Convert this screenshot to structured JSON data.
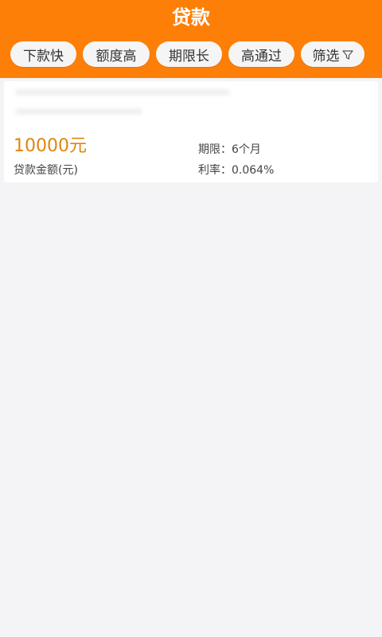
{
  "header": {
    "title": "贷款",
    "background_color": "#fd7f07"
  },
  "filters": [
    {
      "label": "下款快"
    },
    {
      "label": "额度高"
    },
    {
      "label": "期限长"
    },
    {
      "label": "高通过"
    },
    {
      "label": "筛选",
      "icon": "filter-icon"
    }
  ],
  "loan": {
    "amount": "10000元",
    "amount_label": "贷款金额(元)",
    "term": "期限：6个月",
    "rate": "利率：0.064%",
    "amount_color": "#e0850c"
  }
}
